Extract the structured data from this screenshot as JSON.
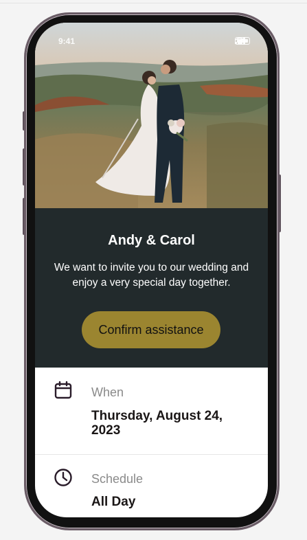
{
  "status_bar": {
    "time": "9:41"
  },
  "invite": {
    "names": "Andy & Carol",
    "message": "We want to invite you to our wedding and enjoy a very special day together.",
    "confirm_label": "Confirm assistance"
  },
  "details": [
    {
      "icon": "calendar-icon",
      "label": "When",
      "value": "Thursday, August 24, 2023"
    },
    {
      "icon": "clock-icon",
      "label": "Schedule",
      "value": "All Day"
    }
  ],
  "colors": {
    "invite_background": "#222a2c",
    "confirm_button": "#9b8530",
    "label_gray": "#8a8a8a",
    "value_text": "#1a1616"
  }
}
